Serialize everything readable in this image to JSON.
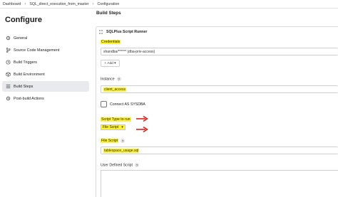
{
  "breadcrumb": {
    "items": [
      "Dashboard",
      "SQL_direct_execution_from_master",
      "Configuration"
    ],
    "separator": "›"
  },
  "page": {
    "title": "Configure"
  },
  "nav": {
    "items": [
      {
        "label": "General",
        "icon": "gear-icon"
      },
      {
        "label": "Source Code Management",
        "icon": "branch-icon"
      },
      {
        "label": "Build Triggers",
        "icon": "clock-icon"
      },
      {
        "label": "Build Environment",
        "icon": "cube-icon"
      },
      {
        "label": "Build Steps",
        "icon": "list-icon"
      },
      {
        "label": "Post-build Actions",
        "icon": "gear-icon"
      }
    ],
    "active_index": 4
  },
  "main": {
    "section_title": "Build Steps",
    "runner_title": "SQLPlus Script Runner",
    "credentials_label": "Credentials",
    "credentials_value": "shandba/****** (dba-priv-access)",
    "add_button_label": "+ Add ▾",
    "instance_label": "Instance",
    "instance_value": "client_access",
    "sysdba_label": "Connect AS SYSDBA",
    "script_type_label": "Script Type to run",
    "script_type_value": "File Script",
    "file_script_label": "File Script",
    "file_script_value": "tablespace_usage.sql",
    "user_defined_label": "User Defined Script",
    "help_glyph": "?"
  },
  "colors": {
    "highlight": "#fff42b",
    "arrow": "#e0201a",
    "active_nav": "#e8eaed"
  }
}
